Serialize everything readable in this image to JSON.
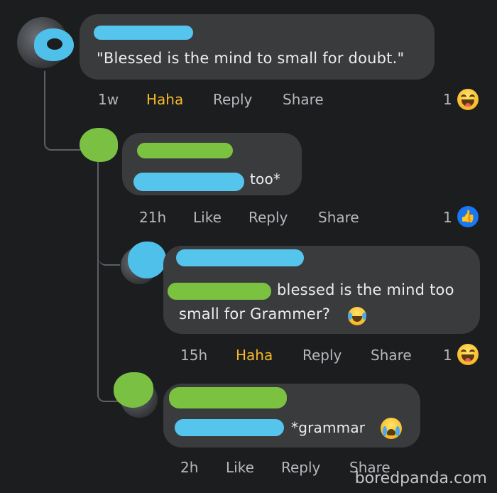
{
  "comments": [
    {
      "text": "\"Blessed is the mind to small for doubt.\"",
      "time": "1w",
      "reaction_action": "Haha",
      "reply": "Reply",
      "share": "Share",
      "reaction_count": "1",
      "reaction_icon": "haha-emoji-icon"
    },
    {
      "text": "too*",
      "time": "21h",
      "reaction_action": "Like",
      "reply": "Reply",
      "share": "Share",
      "reaction_count": "1",
      "reaction_icon": "like-thumb-icon"
    },
    {
      "text_line1": "blessed is the mind too",
      "text_line2": "small for Grammer?",
      "time": "15h",
      "reaction_action": "Haha",
      "reply": "Reply",
      "share": "Share",
      "reaction_count": "1",
      "reaction_icon": "haha-emoji-icon"
    },
    {
      "text": "*grammar",
      "time": "2h",
      "reaction_action": "Like",
      "reply": "Reply",
      "share": "Share"
    }
  ],
  "watermark": "boredpanda.com",
  "colors": {
    "background": "#1c1d1f",
    "bubble": "#3a3b3c",
    "haha_accent": "#f7b928",
    "like_blue": "#1877f2",
    "redaction_blue": "#56c5ee",
    "redaction_green": "#7cc241"
  }
}
